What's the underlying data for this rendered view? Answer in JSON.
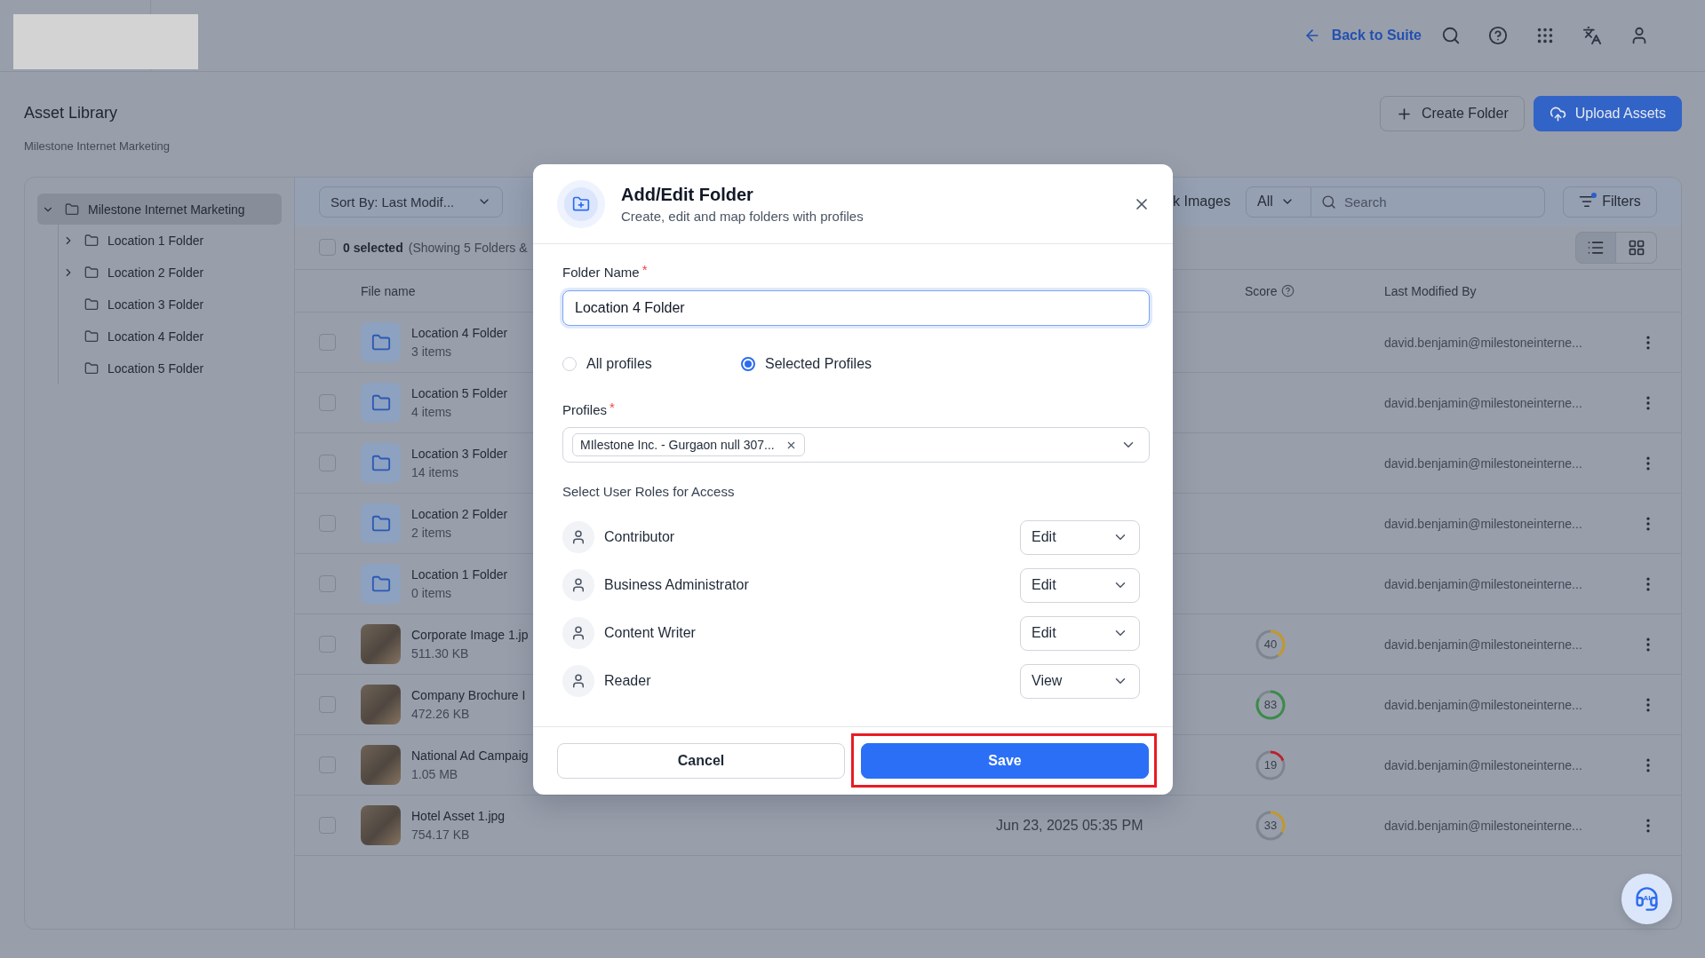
{
  "top_bar": {
    "back_link": "Back to Suite"
  },
  "header": {
    "title": "Asset Library",
    "subtitle": "Milestone Internet Marketing",
    "actions": [
      {
        "label": "Create Folder",
        "kind": "secondary"
      },
      {
        "label": "Upload Assets",
        "kind": "primary"
      }
    ]
  },
  "sidebar": {
    "tree": [
      {
        "label": "Milestone Internet Marketing",
        "kind": "branch",
        "expanded": true,
        "selected": true,
        "children": [
          {
            "label": "Location 1 Folder",
            "kind": "branch",
            "expanded": false,
            "selected": false
          },
          {
            "label": "Location 2 Folder",
            "kind": "branch",
            "expanded": false,
            "selected": false
          },
          {
            "label": "Location 3 Folder",
            "kind": "leaf",
            "selected": false
          },
          {
            "label": "Location 4 Folder",
            "kind": "leaf",
            "selected": false
          },
          {
            "label": "Location 5 Folder",
            "kind": "leaf",
            "selected": false
          }
        ]
      }
    ]
  },
  "toolbar": {
    "sort": "Sort By: Last Modif...",
    "stock_label": "k Images",
    "type_filter": "All",
    "search": {
      "placeholder": "Search"
    },
    "filters": {
      "label": "Filters",
      "active": true
    }
  },
  "selection_bar": {
    "checked": false,
    "count": "0 selected",
    "summary": "(Showing 5 Folders &",
    "views": [
      {
        "kind": "list",
        "selected": true
      },
      {
        "kind": "grid",
        "selected": false
      }
    ]
  },
  "table": {
    "columns": [
      {
        "label": "File name",
        "kind": "name"
      },
      {
        "label": "Score",
        "kind": "score"
      },
      {
        "label": "Last Modified By",
        "kind": "user"
      }
    ],
    "rows": [
      {
        "kind": "folder",
        "checked": false,
        "name": "Location 4 Folder",
        "meta": "3 items",
        "modified_by": "david.benjamin@milestoneinterne..."
      },
      {
        "kind": "folder",
        "checked": false,
        "name": "Location 5 Folder",
        "meta": "4 items",
        "modified_by": "david.benjamin@milestoneinterne..."
      },
      {
        "kind": "folder",
        "checked": false,
        "name": "Location 3 Folder",
        "meta": "14 items",
        "modified_by": "david.benjamin@milestoneinterne..."
      },
      {
        "kind": "folder",
        "checked": false,
        "name": "Location 2 Folder",
        "meta": "2 items",
        "modified_by": "david.benjamin@milestoneinterne..."
      },
      {
        "kind": "folder",
        "checked": false,
        "name": "Location 1 Folder",
        "meta": "0 items",
        "modified_by": "david.benjamin@milestoneinterne..."
      },
      {
        "kind": "image",
        "checked": false,
        "name": "Corporate Image 1.jp",
        "meta": "511.30 KB",
        "score": {
          "value": "40",
          "level": 0.4,
          "color": "#c0982e"
        },
        "modified_by": "david.benjamin@milestoneinterne..."
      },
      {
        "kind": "image",
        "checked": false,
        "name": "Company Brochure I",
        "meta": "472.26 KB",
        "score": {
          "value": "83",
          "level": 0.83,
          "color": "#3d8a4a"
        },
        "modified_by": "david.benjamin@milestoneinterne..."
      },
      {
        "kind": "image",
        "checked": false,
        "name": "National Ad Campaig",
        "meta": "1.05 MB",
        "score": {
          "value": "19",
          "level": 0.19,
          "color": "#bb2129"
        },
        "modified_by": "david.benjamin@milestoneinterne..."
      },
      {
        "kind": "image",
        "checked": false,
        "name": "Hotel Asset 1.jpg",
        "meta": "754.17 KB",
        "modified": "Jun 23, 2025 05:35 PM",
        "score": {
          "value": "33",
          "level": 0.33,
          "color": "#c0982e"
        },
        "modified_by": "david.benjamin@milestoneinterne..."
      }
    ]
  },
  "assistant_button": {
    "label": "AI"
  },
  "modal": {
    "title": "Add/Edit Folder",
    "subtitle": "Create, edit and map folders with profiles",
    "folder_name": {
      "label": "Folder Name",
      "required_mark": "*",
      "value": "Location 4 Folder",
      "focused": true
    },
    "scope_options": [
      {
        "label": "All profiles",
        "selected": false
      },
      {
        "label": "Selected Profiles",
        "selected": true
      }
    ],
    "profiles": {
      "label": "Profiles",
      "required_mark": "*",
      "chips": [
        "MIlestone Inc. - Gurgaon null 307..."
      ]
    },
    "roles_heading": "Select User Roles for Access",
    "roles": [
      {
        "name": "Contributor",
        "access": "Edit"
      },
      {
        "name": "Business Administrator",
        "access": "Edit"
      },
      {
        "name": "Content Writer",
        "access": "Edit"
      },
      {
        "name": "Reader",
        "access": "View"
      }
    ],
    "buttons": [
      {
        "label": "Cancel",
        "kind": "secondary",
        "highlighted": false
      },
      {
        "label": "Save",
        "kind": "primary",
        "highlighted": true
      }
    ]
  }
}
